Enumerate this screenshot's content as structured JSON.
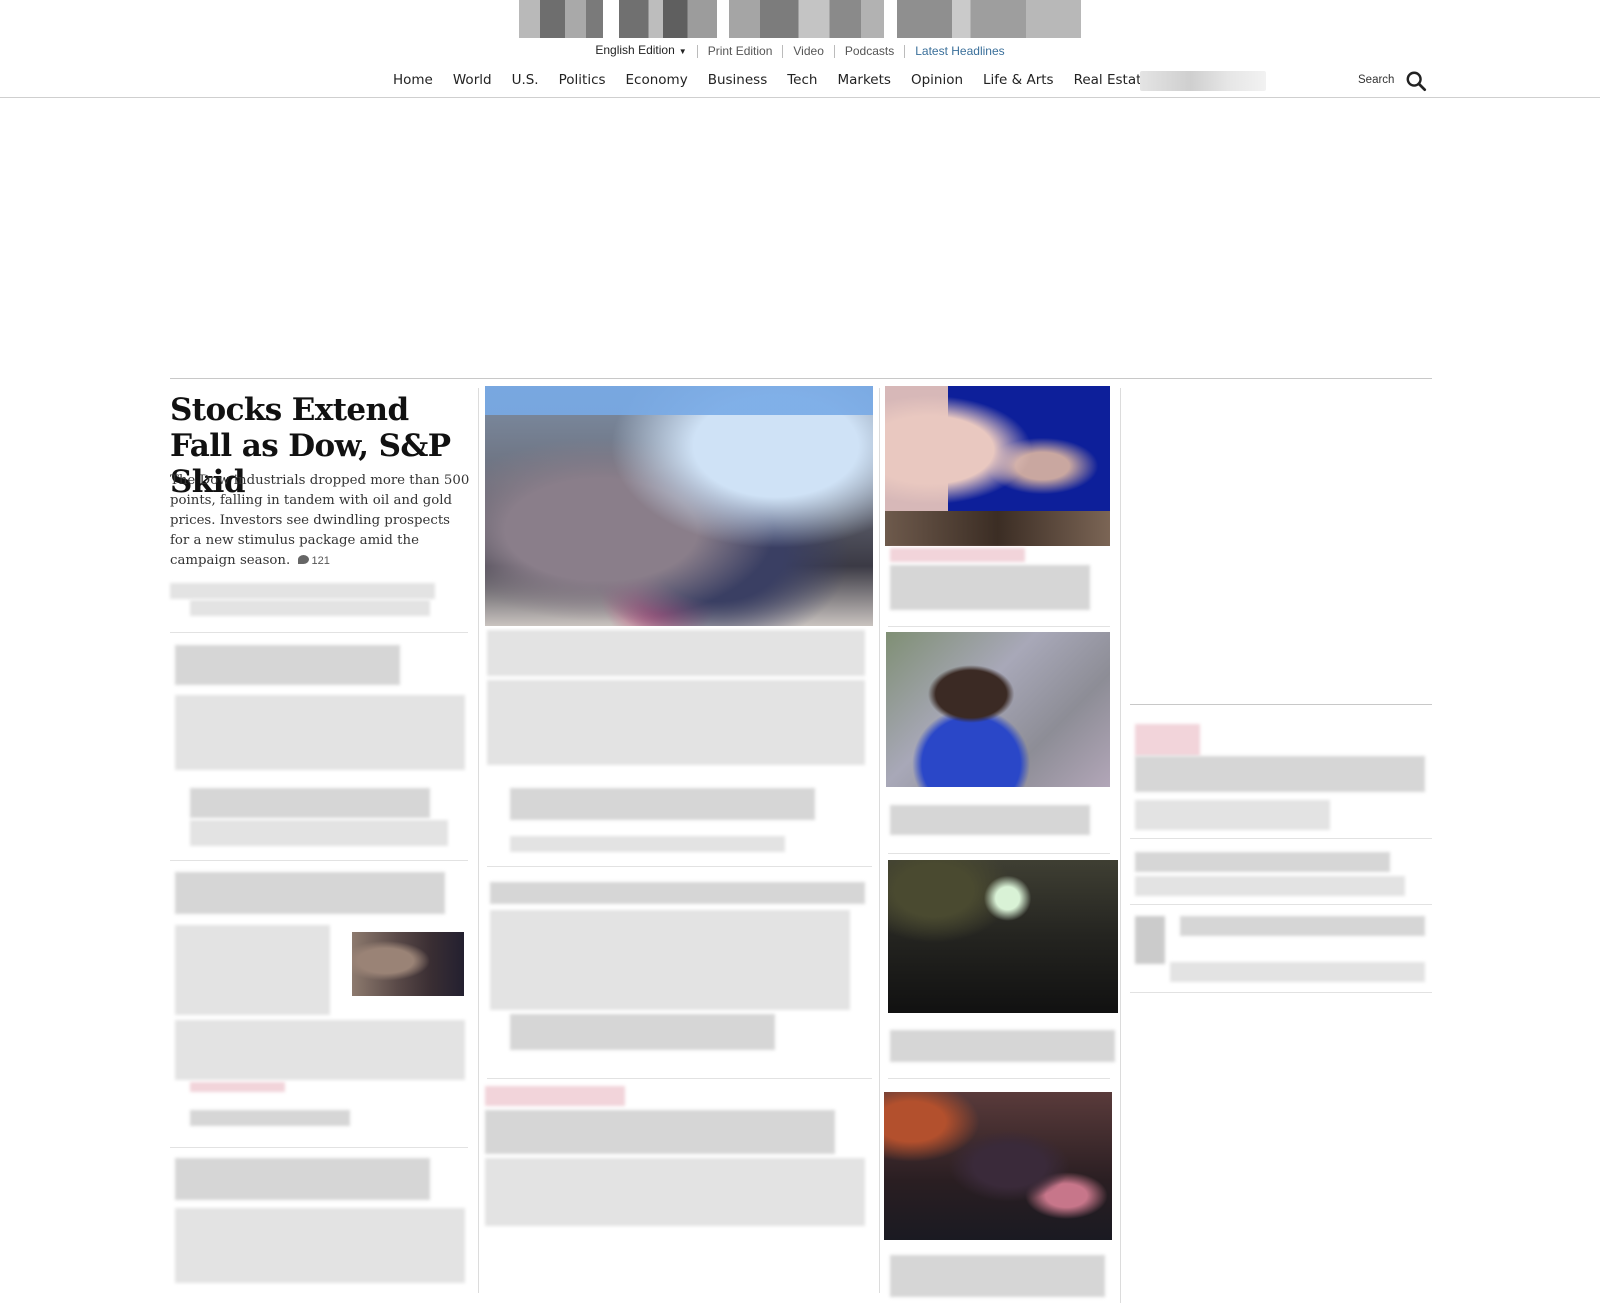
{
  "edition_bar": {
    "edition_label": "English Edition",
    "edition_caret": "▼",
    "links": [
      "Print Edition",
      "Video",
      "Podcasts"
    ],
    "latest_headlines": "Latest Headlines"
  },
  "nav": {
    "items": [
      "Home",
      "World",
      "U.S.",
      "Politics",
      "Economy",
      "Business",
      "Tech",
      "Markets",
      "Opinion",
      "Life & Arts",
      "Real Estate"
    ],
    "search_label": "Search"
  },
  "lead_story": {
    "headline": "Stocks Extend Fall as Dow, S&P Skid",
    "summary": "The Dow industrials dropped more than 500 points, falling in tandem with oil and gold prices. Investors see dwindling prospects for a new stimulus package amid the campaign season.",
    "comment_count": "121"
  },
  "colors": {
    "latest_headlines_link": "#3a6f9a",
    "rule": "#cfcfcf"
  },
  "icons": {
    "search": "search-icon",
    "comment": "comment-icon",
    "edition_dropdown": "chevron-down-icon"
  }
}
